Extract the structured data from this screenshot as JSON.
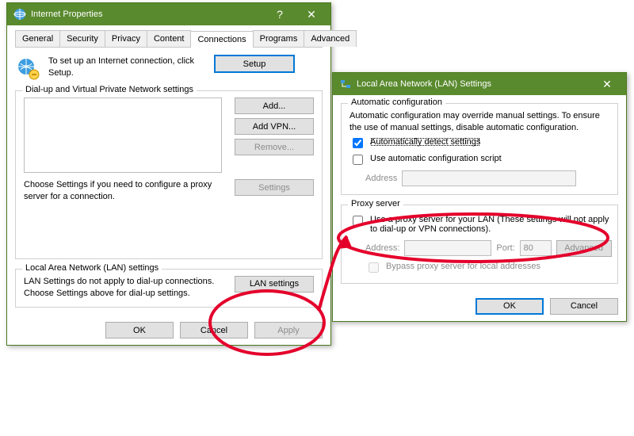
{
  "dialog1": {
    "title": "Internet Properties",
    "tabs": [
      "General",
      "Security",
      "Privacy",
      "Content",
      "Connections",
      "Programs",
      "Advanced"
    ],
    "active_tab": "Connections",
    "setup_text": "To set up an Internet connection, click Setup.",
    "setup_btn": "Setup",
    "dialup_legend": "Dial-up and Virtual Private Network settings",
    "add_btn": "Add...",
    "addvpn_btn": "Add VPN...",
    "remove_btn": "Remove...",
    "settings_btn": "Settings",
    "choose_text": "Choose Settings if you need to configure a proxy server for a connection.",
    "lan_legend": "Local Area Network (LAN) settings",
    "lan_text": "LAN Settings do not apply to dial-up connections. Choose Settings above for dial-up settings.",
    "lan_btn": "LAN settings",
    "ok": "OK",
    "cancel": "Cancel",
    "apply": "Apply"
  },
  "dialog2": {
    "title": "Local Area Network (LAN) Settings",
    "auto_legend": "Automatic configuration",
    "auto_text": "Automatic configuration may override manual settings.  To ensure the use of manual settings, disable automatic configuration.",
    "auto_detect": "Automatically detect settings",
    "auto_script": "Use automatic configuration script",
    "address_label": "Address",
    "proxy_legend": "Proxy server",
    "proxy_use": "Use a proxy server for your LAN (These settings will not apply to dial-up or VPN connections).",
    "proxy_address": "Address:",
    "proxy_port": "Port:",
    "proxy_port_value": "80",
    "advanced_btn": "Advanced",
    "bypass": "Bypass proxy server for local addresses",
    "ok": "OK",
    "cancel": "Cancel"
  },
  "annotation": {
    "color": "#e4002b"
  }
}
